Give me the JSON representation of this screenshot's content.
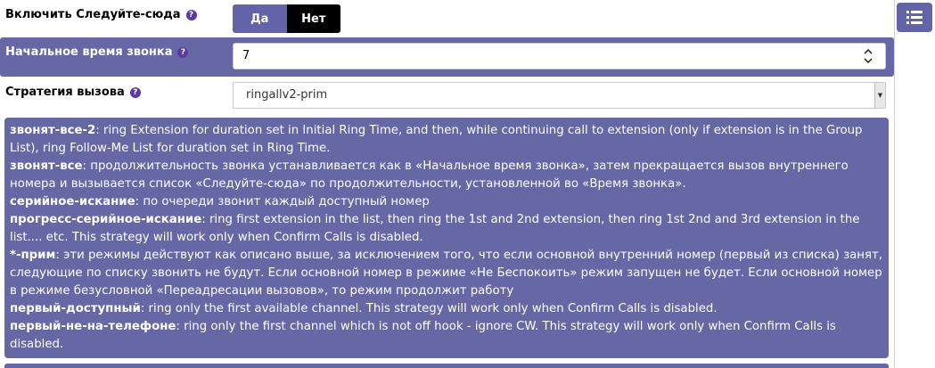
{
  "follow_me": {
    "label": "Включить Следуйте-сюда",
    "help": "?",
    "yes_label": "Да",
    "no_label": "Нет"
  },
  "initial_ring_time": {
    "label": "Начальное время звонка",
    "help": "?",
    "value": "7"
  },
  "ring_strategy": {
    "label": "Стратегия вызова",
    "help": "?",
    "selected": "ringallv2-prim"
  },
  "help_panel": {
    "items": [
      {
        "term": "звонят-все-2",
        "desc": ": ring Extension for duration set in Initial Ring Time, and then, while continuing call to extension (only if extension is in the Group List), ring Follow-Me List for duration set in Ring Time."
      },
      {
        "term": "звонят-все",
        "desc": ": продолжительность звонка устанавливается как в «Начальное время звонка», затем прекращается вызов внутреннего номера и вызывается список «Следуйте-сюда» по продолжительности, установленной во «Время звонка»."
      },
      {
        "term": "серийное-искание",
        "desc": ": по очереди звонит каждый доступный номер"
      },
      {
        "term": "прогресс-серийное-искание",
        "desc": ": ring first extension in the list, then ring the 1st and 2nd extension, then ring 1st 2nd and 3rd extension in the list.... etc. This strategy will work only when Confirm Calls is disabled."
      },
      {
        "term": "*-прим",
        "desc": ": эти режимы действуют как описано выше, за исключением того, что если основной внутренний номер (первый из списка) занят, следующие по списку звонить не будут. Если основной номер в режиме «Не Беспокоить» режим запущен не будет. Если основной номер в режиме безусловной «Переадресации вызовов», то режим продолжит работу"
      },
      {
        "term": "первый-доступный",
        "desc": ": ring only the first available channel. This strategy will work only when Confirm Calls is disabled."
      },
      {
        "term": "первый-не-на-телефоне",
        "desc": ": ring only the first channel which is not off hook - ignore CW. This strategy will work only when Confirm Calls is disabled."
      }
    ]
  },
  "colors": {
    "accent": "#6668a6",
    "toggle_active": "#6263a8",
    "help_icon": "#5c3ba0"
  },
  "icons": {
    "side_button": "list-icon",
    "help": "help-circle-icon",
    "spinner": "spinner-arrows-icon",
    "select": "dropdown-arrow-icon"
  }
}
